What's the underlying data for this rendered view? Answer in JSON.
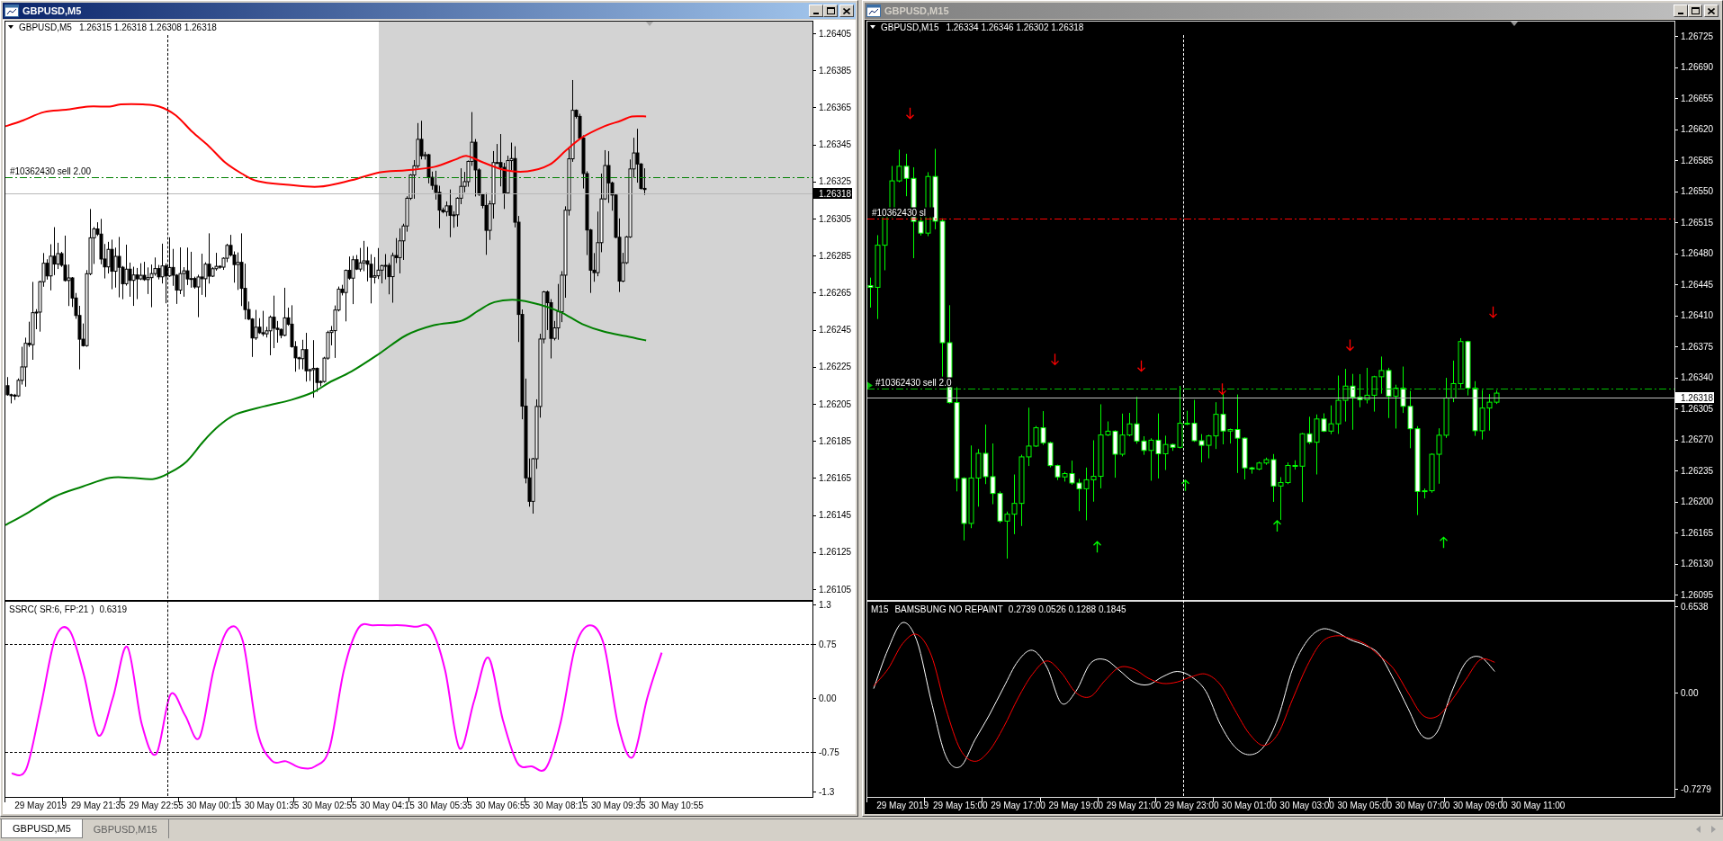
{
  "windows": [
    {
      "title": "GBPUSD,M5",
      "active": true,
      "kind": "light",
      "header": {
        "symbol": "GBPUSD,M5",
        "quotes": "1.26315 1.26318 1.26308 1.26318"
      },
      "order_lines": [
        {
          "kind": "entry",
          "label": "#10362430 sell 2.00",
          "entry_marker": false
        }
      ],
      "price_ticks": [
        "1.26405",
        "1.26385",
        "1.26365",
        "1.26345",
        "1.26325",
        "1.26305",
        "1.26285",
        "1.26265",
        "1.26245",
        "1.26225",
        "1.26205",
        "1.26185",
        "1.26165",
        "1.26145",
        "1.26125",
        "1.26105"
      ],
      "current_price": "1.26318",
      "indicator": {
        "name": "SSRC( SR:6, FP:21 )",
        "values": "0.6319",
        "chart_data": {
          "type": "line",
          "categories": [
            null,
            null,
            "29 May 2019",
            null,
            null,
            null,
            "29 May 21:35",
            null,
            null,
            null,
            "29 May 22:55",
            null,
            null,
            null,
            "30 May 00:15",
            null,
            null,
            null,
            "30 May 01:35",
            null,
            null,
            null,
            "30 May 02:55",
            null,
            null,
            null,
            "30 May 04:15",
            null,
            null,
            null,
            "30 May 05:35",
            null,
            null,
            null,
            "30 May 06:55",
            null,
            null,
            null,
            "30 May 08:15",
            null,
            null,
            null,
            "30 May 09:35",
            null,
            null,
            null,
            "30 May 10:55",
            null,
            null,
            null,
            null,
            null,
            null,
            null,
            null,
            null
          ],
          "series": [
            {
              "color": "#ff00ff",
              "values": [
                -1.05,
                -0.99,
                -0.13,
                0.82,
                0.94,
                0.32,
                -0.52,
                0.0,
                0.71,
                -0.36,
                -0.78,
                0.05,
                -0.24,
                -0.55,
                0.41,
                0.96,
                0.79,
                -0.46,
                -0.87,
                -0.88,
                -0.97,
                -0.95,
                -0.7,
                0.39,
                0.97,
                1.01,
                1.01,
                1.01,
                0.99,
                0.97,
                0.39,
                -0.7,
                -0.05,
                0.56,
                -0.3,
                -0.9,
                -0.95,
                -0.97,
                -0.34,
                0.7,
                1.01,
                0.74,
                -0.39,
                -0.82,
                0.0,
                0.63,
                null,
                null,
                null,
                null,
                null,
                null,
                null,
                null,
                null,
                null
              ]
            }
          ],
          "ylim": [
            -1.3875,
            1.35
          ],
          "yticks": [
            {
              "value": 1.3,
              "label": "1.3"
            },
            {
              "value": 0.75,
              "label": "0.75"
            },
            {
              "value": 0,
              "label": "0.00"
            },
            {
              "value": -0.75,
              "label": "-0.75"
            },
            {
              "value": -1.3,
              "label": "-1.3"
            }
          ]
        }
      }
    },
    {
      "title": "GBPUSD,M15",
      "active": false,
      "kind": "dark",
      "header": {
        "symbol": "GBPUSD,M15",
        "quotes": "1.26334 1.26346 1.26302 1.26318"
      },
      "order_lines": [
        {
          "kind": "stop",
          "label": "#10362430 sl",
          "entry_marker": false
        },
        {
          "kind": "entry",
          "label": "#10362430 sell 2.0",
          "entry_marker": true
        }
      ],
      "price_ticks": [
        "1.26725",
        "1.26690",
        "1.26655",
        "1.26620",
        "1.26585",
        "1.26550",
        "1.26515",
        "1.26480",
        "1.26445",
        "1.26410",
        "1.26375",
        "1.26340",
        "1.26305",
        "1.26270",
        "1.26235",
        "1.26200",
        "1.26165",
        "1.26130",
        "1.26095"
      ],
      "current_price": "1.26318",
      "indicator": {
        "timeframe": "M15",
        "name": "BAMSBUNG NO REPAINT",
        "values": "0.2739 0.0526 0.1288 0.1845",
        "chart_data": {
          "type": "line",
          "categories": [
            null,
            null,
            "29 May 2019",
            null,
            null,
            null,
            "29 May 15:00",
            null,
            null,
            null,
            "29 May 17:00",
            null,
            null,
            null,
            "29 May 19:00",
            null,
            null,
            null,
            "29 May 21:00",
            null,
            null,
            null,
            "29 May 23:00",
            null,
            null,
            null,
            "30 May 01:00",
            null,
            null,
            null,
            "30 May 03:00",
            null,
            null,
            null,
            "30 May 05:00",
            null,
            null,
            null,
            "30 May 07:00",
            null,
            null,
            null,
            "30 May 09:00",
            null,
            null,
            null,
            "30 May 11:00",
            null,
            null,
            null,
            null,
            null,
            null,
            null,
            null,
            null
          ],
          "series": [
            {
              "color": "#ffffff",
              "values": [
                0.03,
                0.33,
                0.53,
                0.39,
                -0.07,
                -0.48,
                -0.56,
                -0.36,
                -0.17,
                0.04,
                0.24,
                0.32,
                0.19,
                -0.08,
                0.01,
                0.22,
                0.25,
                0.17,
                0.08,
                0.06,
                0.12,
                0.16,
                0.12,
                0.01,
                -0.24,
                -0.41,
                -0.47,
                -0.41,
                -0.19,
                0.18,
                0.39,
                0.48,
                0.46,
                0.4,
                0.36,
                0.29,
                0.1,
                -0.12,
                -0.33,
                -0.3,
                0.0,
                0.23,
                0.27,
                0.16,
                null,
                null,
                null,
                null,
                null,
                null,
                null,
                null,
                null,
                null,
                null,
                null
              ]
            },
            {
              "color": "#ff0000",
              "values": [
                0.05,
                0.18,
                0.37,
                0.44,
                0.28,
                -0.12,
                -0.43,
                -0.52,
                -0.44,
                -0.26,
                -0.04,
                0.14,
                0.24,
                0.15,
                0.0,
                -0.03,
                0.09,
                0.19,
                0.18,
                0.11,
                0.07,
                0.08,
                0.12,
                0.14,
                0.06,
                -0.13,
                -0.31,
                -0.4,
                -0.31,
                -0.05,
                0.2,
                0.38,
                0.43,
                0.41,
                0.37,
                0.28,
                0.18,
                0.0,
                -0.17,
                -0.18,
                -0.06,
                0.1,
                0.25,
                0.23,
                null,
                null,
                null,
                null,
                null,
                null,
                null,
                null,
                null,
                null,
                null,
                null
              ]
            }
          ],
          "ylim": [
            -0.796,
            0.6946
          ],
          "yticks": [
            {
              "value": 0.6538,
              "label": "0.6538"
            },
            {
              "value": 0,
              "label": "0.00"
            },
            {
              "value": -0.7279,
              "label": "-0.7279"
            }
          ]
        }
      }
    }
  ],
  "tabs": [
    {
      "label": "GBPUSD,M5",
      "selected": true
    },
    {
      "label": "GBPUSD,M15",
      "selected": false
    }
  ]
}
